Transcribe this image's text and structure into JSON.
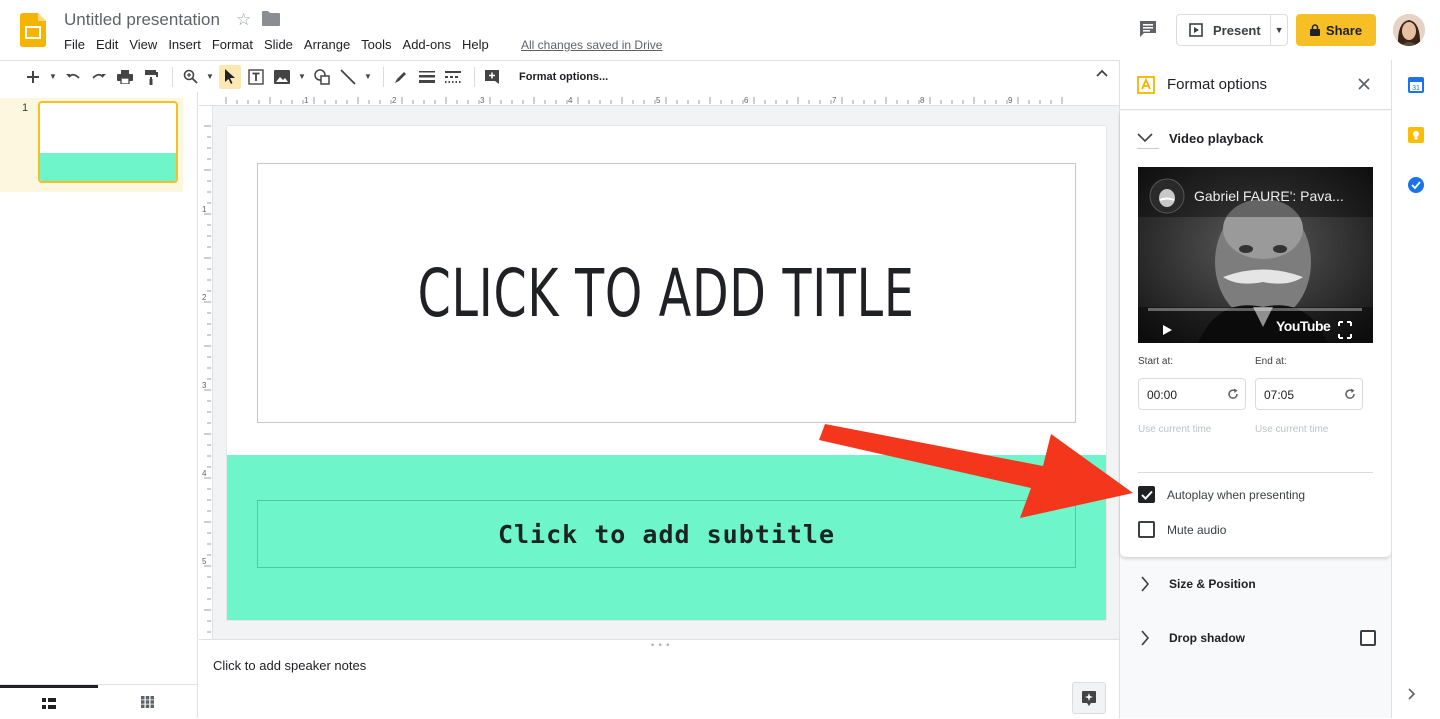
{
  "header": {
    "doc_title": "Untitled presentation",
    "save_status": "All changes saved in Drive",
    "present_label": "Present",
    "share_label": "Share",
    "menu": [
      "File",
      "Edit",
      "View",
      "Insert",
      "Format",
      "Slide",
      "Arrange",
      "Tools",
      "Add-ons",
      "Help"
    ]
  },
  "toolbar": {
    "format_options_label": "Format options..."
  },
  "filmstrip": {
    "slides": [
      {
        "number": "1"
      }
    ]
  },
  "ruler": {
    "h_numbers": [
      "1",
      "2",
      "3",
      "4",
      "5",
      "6",
      "7",
      "8",
      "9"
    ],
    "v_numbers": [
      "1",
      "2",
      "3",
      "4",
      "5"
    ]
  },
  "slide": {
    "title_placeholder": "Click to add title",
    "subtitle_placeholder": "Click to add subtitle",
    "band_color": "#6ef5c9"
  },
  "notes": {
    "placeholder": "Click to add speaker notes"
  },
  "panel": {
    "title": "Format options",
    "video_section_title": "Video playback",
    "video_title": "Gabriel FAURE': Pava...",
    "video_brand": "YouTube",
    "start_label": "Start at:",
    "end_label": "End at:",
    "start_value": "00:00",
    "end_value": "07:05",
    "use_current_label": "Use current time",
    "autoplay_label": "Autoplay when presenting",
    "autoplay_checked": true,
    "mute_label": "Mute audio",
    "mute_checked": false,
    "size_section_title": "Size & Position",
    "shadow_section_title": "Drop shadow"
  },
  "colors": {
    "accent_yellow": "#f6bf26",
    "arrow_red": "#f4361c",
    "slide_band": "#6ef5c9"
  }
}
